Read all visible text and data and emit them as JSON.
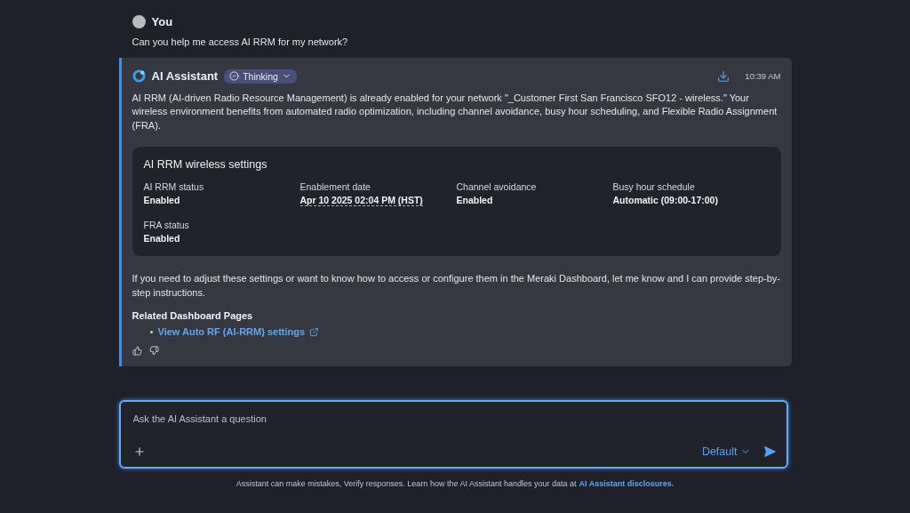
{
  "user_message": {
    "author": "You",
    "text": "Can you help me access AI RRM for my network?"
  },
  "assistant_message": {
    "author": "AI Assistant",
    "status_badge": "Thinking",
    "time": "10:39 AM",
    "intro": "AI RRM (AI-driven Radio Resource Management) is already enabled for your network \"_Customer First San Francisco SFO12 - wireless.\" Your wireless environment benefits from automated radio optimization, including channel avoidance, busy hour scheduling, and Flexible Radio Assignment (FRA).",
    "settings_card": {
      "title": "AI RRM wireless settings",
      "items": [
        {
          "label": "AI RRM status",
          "value": "Enabled",
          "kind": "plain"
        },
        {
          "label": "Enablement date",
          "value": "Apr 10 2025 02:04 PM (HST)",
          "kind": "dotted"
        },
        {
          "label": "Channel avoidance",
          "value": "Enabled",
          "kind": "plain"
        },
        {
          "label": "Busy hour schedule",
          "value": "Automatic (09:00-17:00)",
          "kind": "plain"
        },
        {
          "label": "FRA status",
          "value": "Enabled",
          "kind": "plain"
        }
      ]
    },
    "outro": "If you need to adjust these settings or want to know how to access or configure them in the Meraki Dashboard, let me know and I can provide step-by-step instructions.",
    "related_heading": "Related Dashboard Pages",
    "related_links": [
      "View Auto RF (AI-RRM) settings"
    ]
  },
  "composer": {
    "placeholder": "Ask the AI Assistant a question",
    "mode": "Default"
  },
  "disclaimer": {
    "text": "Assistant can make mistakes, Verify responses. Learn how the AI Assistant handles your data at",
    "link": "AI Assistant disclosures."
  }
}
